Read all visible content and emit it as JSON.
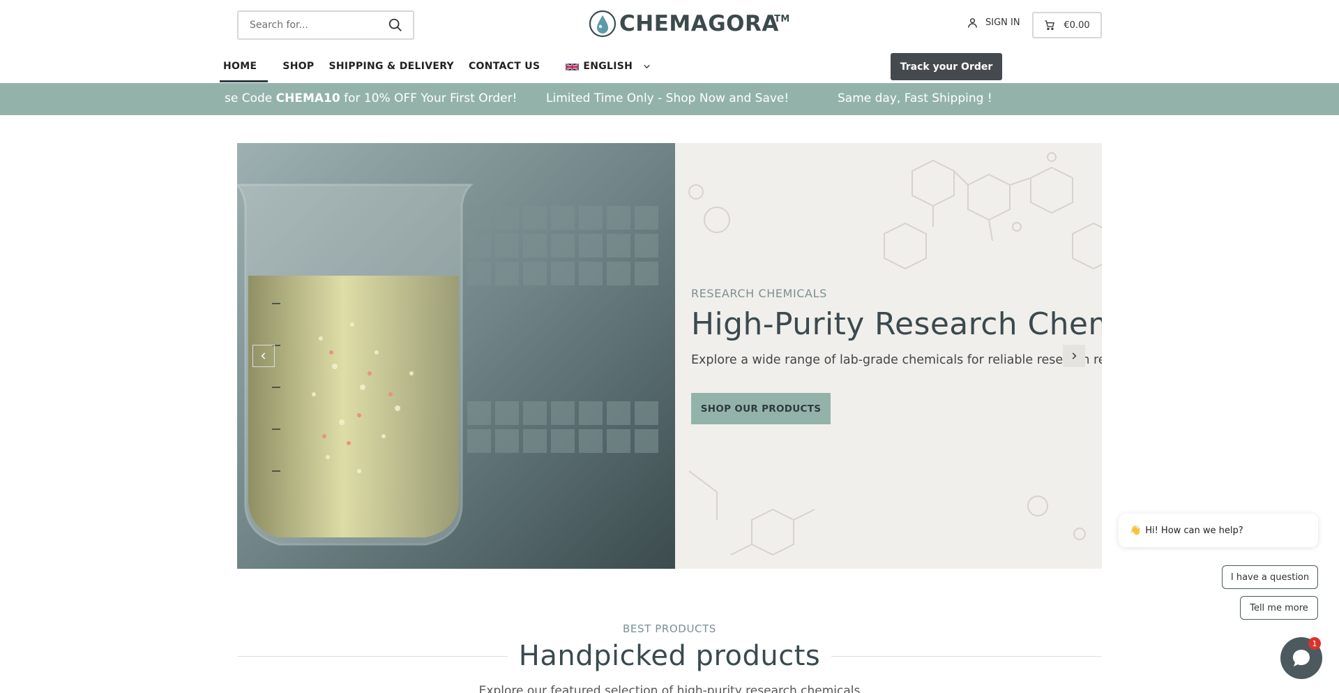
{
  "header": {
    "search_placeholder": "Search for...",
    "logo_text": "CHEMAGORA",
    "logo_tm": "TM",
    "sign_in": "SIGN IN",
    "cart_total": "€0.00",
    "track_order": "Track your Order"
  },
  "nav": {
    "items": [
      "HOME",
      "SHOP",
      "SHIPPING & DELIVERY",
      "CONTACT US"
    ],
    "language": "ENGLISH"
  },
  "ticker": {
    "item1_prefix": "se Code ",
    "item1_code": "CHEMA10",
    "item1_suffix": " for 10% OFF Your First Order!",
    "item2": " Limited Time Only - Shop Now and Save!",
    "item3": " Same day, Fast Shipping !"
  },
  "hero": {
    "eyebrow": "RESEARCH CHEMICALS",
    "title": "High-Purity Research Chemicals",
    "subtitle": "Explore a wide range of lab-grade chemicals for reliable research results",
    "button": "SHOP OUR PRODUCTS"
  },
  "section": {
    "eyebrow": "BEST PRODUCTS",
    "title": "Handpicked products",
    "subtitle": "Explore our featured selection of high-purity research chemicals"
  },
  "chat": {
    "greeting": "Hi! How can we help?",
    "option_question": "I have a question",
    "option_more": "Tell me more",
    "badge": "1"
  },
  "colors": {
    "accent_green": "#93b3aa",
    "dark_button": "#454a4f",
    "title_text": "#3a4a4f",
    "chat_badge": "#d9322e"
  },
  "icons": [
    "search-icon",
    "user-icon",
    "cart-icon",
    "uk-flag-icon",
    "chevron-down-icon",
    "chevron-left-icon",
    "chevron-right-icon",
    "chat-icon"
  ]
}
